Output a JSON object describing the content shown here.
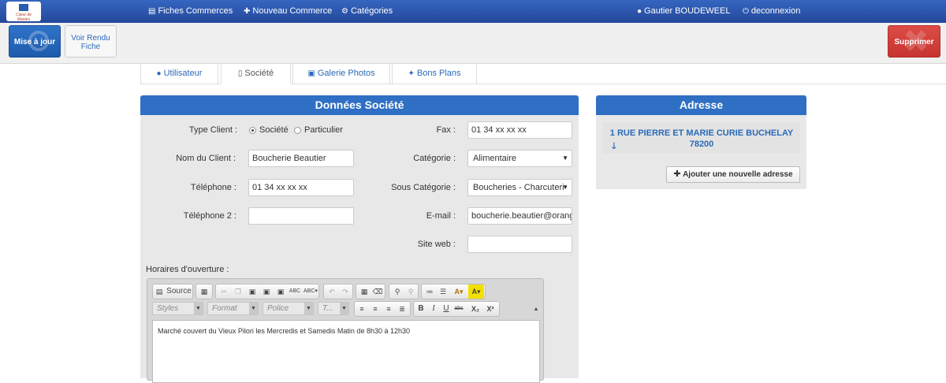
{
  "nav": {
    "logo_text": "Cœur de Mantes",
    "fiches": "Fiches Commerces",
    "nouveau": "Nouveau Commerce",
    "categories": "Catégories",
    "user": "Gautier BOUDEWEEL",
    "logout": "deconnexion"
  },
  "toolbar": {
    "update": "Mise à jour",
    "view_line1": "Voir Rendu",
    "view_line2": "Fiche",
    "delete": "Supprimer"
  },
  "tabs": [
    "Utilisateur",
    "Société",
    "Galerie Photos",
    "Bons Plans"
  ],
  "societe": {
    "title": "Données Société",
    "type_client_label": "Type Client :",
    "type_options": [
      "Société",
      "Particulier"
    ],
    "type_selected": "Société",
    "nom_label": "Nom du Client :",
    "nom_value": "Boucherie Beautier",
    "tel_label": "Téléphone :",
    "tel_value": "01 34 xx xx xx",
    "tel2_label": "Téléphone 2 :",
    "tel2_value": "",
    "fax_label": "Fax :",
    "fax_value": "01 34 xx xx xx",
    "categorie_label": "Catégorie :",
    "categorie_value": "Alimentaire",
    "sous_cat_label": "Sous Catégorie :",
    "sous_cat_value": "Boucheries - Charcuteri",
    "email_label": "E-mail :",
    "email_value": "boucherie.beautier@orange",
    "site_label": "Site web :",
    "site_value": "",
    "horaires_label": "Horaires d'ouverture :"
  },
  "editor": {
    "source": "Source",
    "styles": "Styles",
    "format": "Format",
    "police": "Police",
    "taille": "T...",
    "content": "Marché couvert du Vieux Pilori  les Mercredis et Samedis Matin de 8h30 à 12h30"
  },
  "adresse": {
    "title": "Adresse",
    "line1": "1 RUE PIERRE ET MARIE CURIE BUCHELAY",
    "line2": "78200",
    "add_button": "Ajouter une nouvelle adresse"
  },
  "colors": {
    "navbar": "#2a53a8",
    "primary": "#2f6fc4",
    "danger": "#d23f3b",
    "link": "#2a6ab8"
  }
}
